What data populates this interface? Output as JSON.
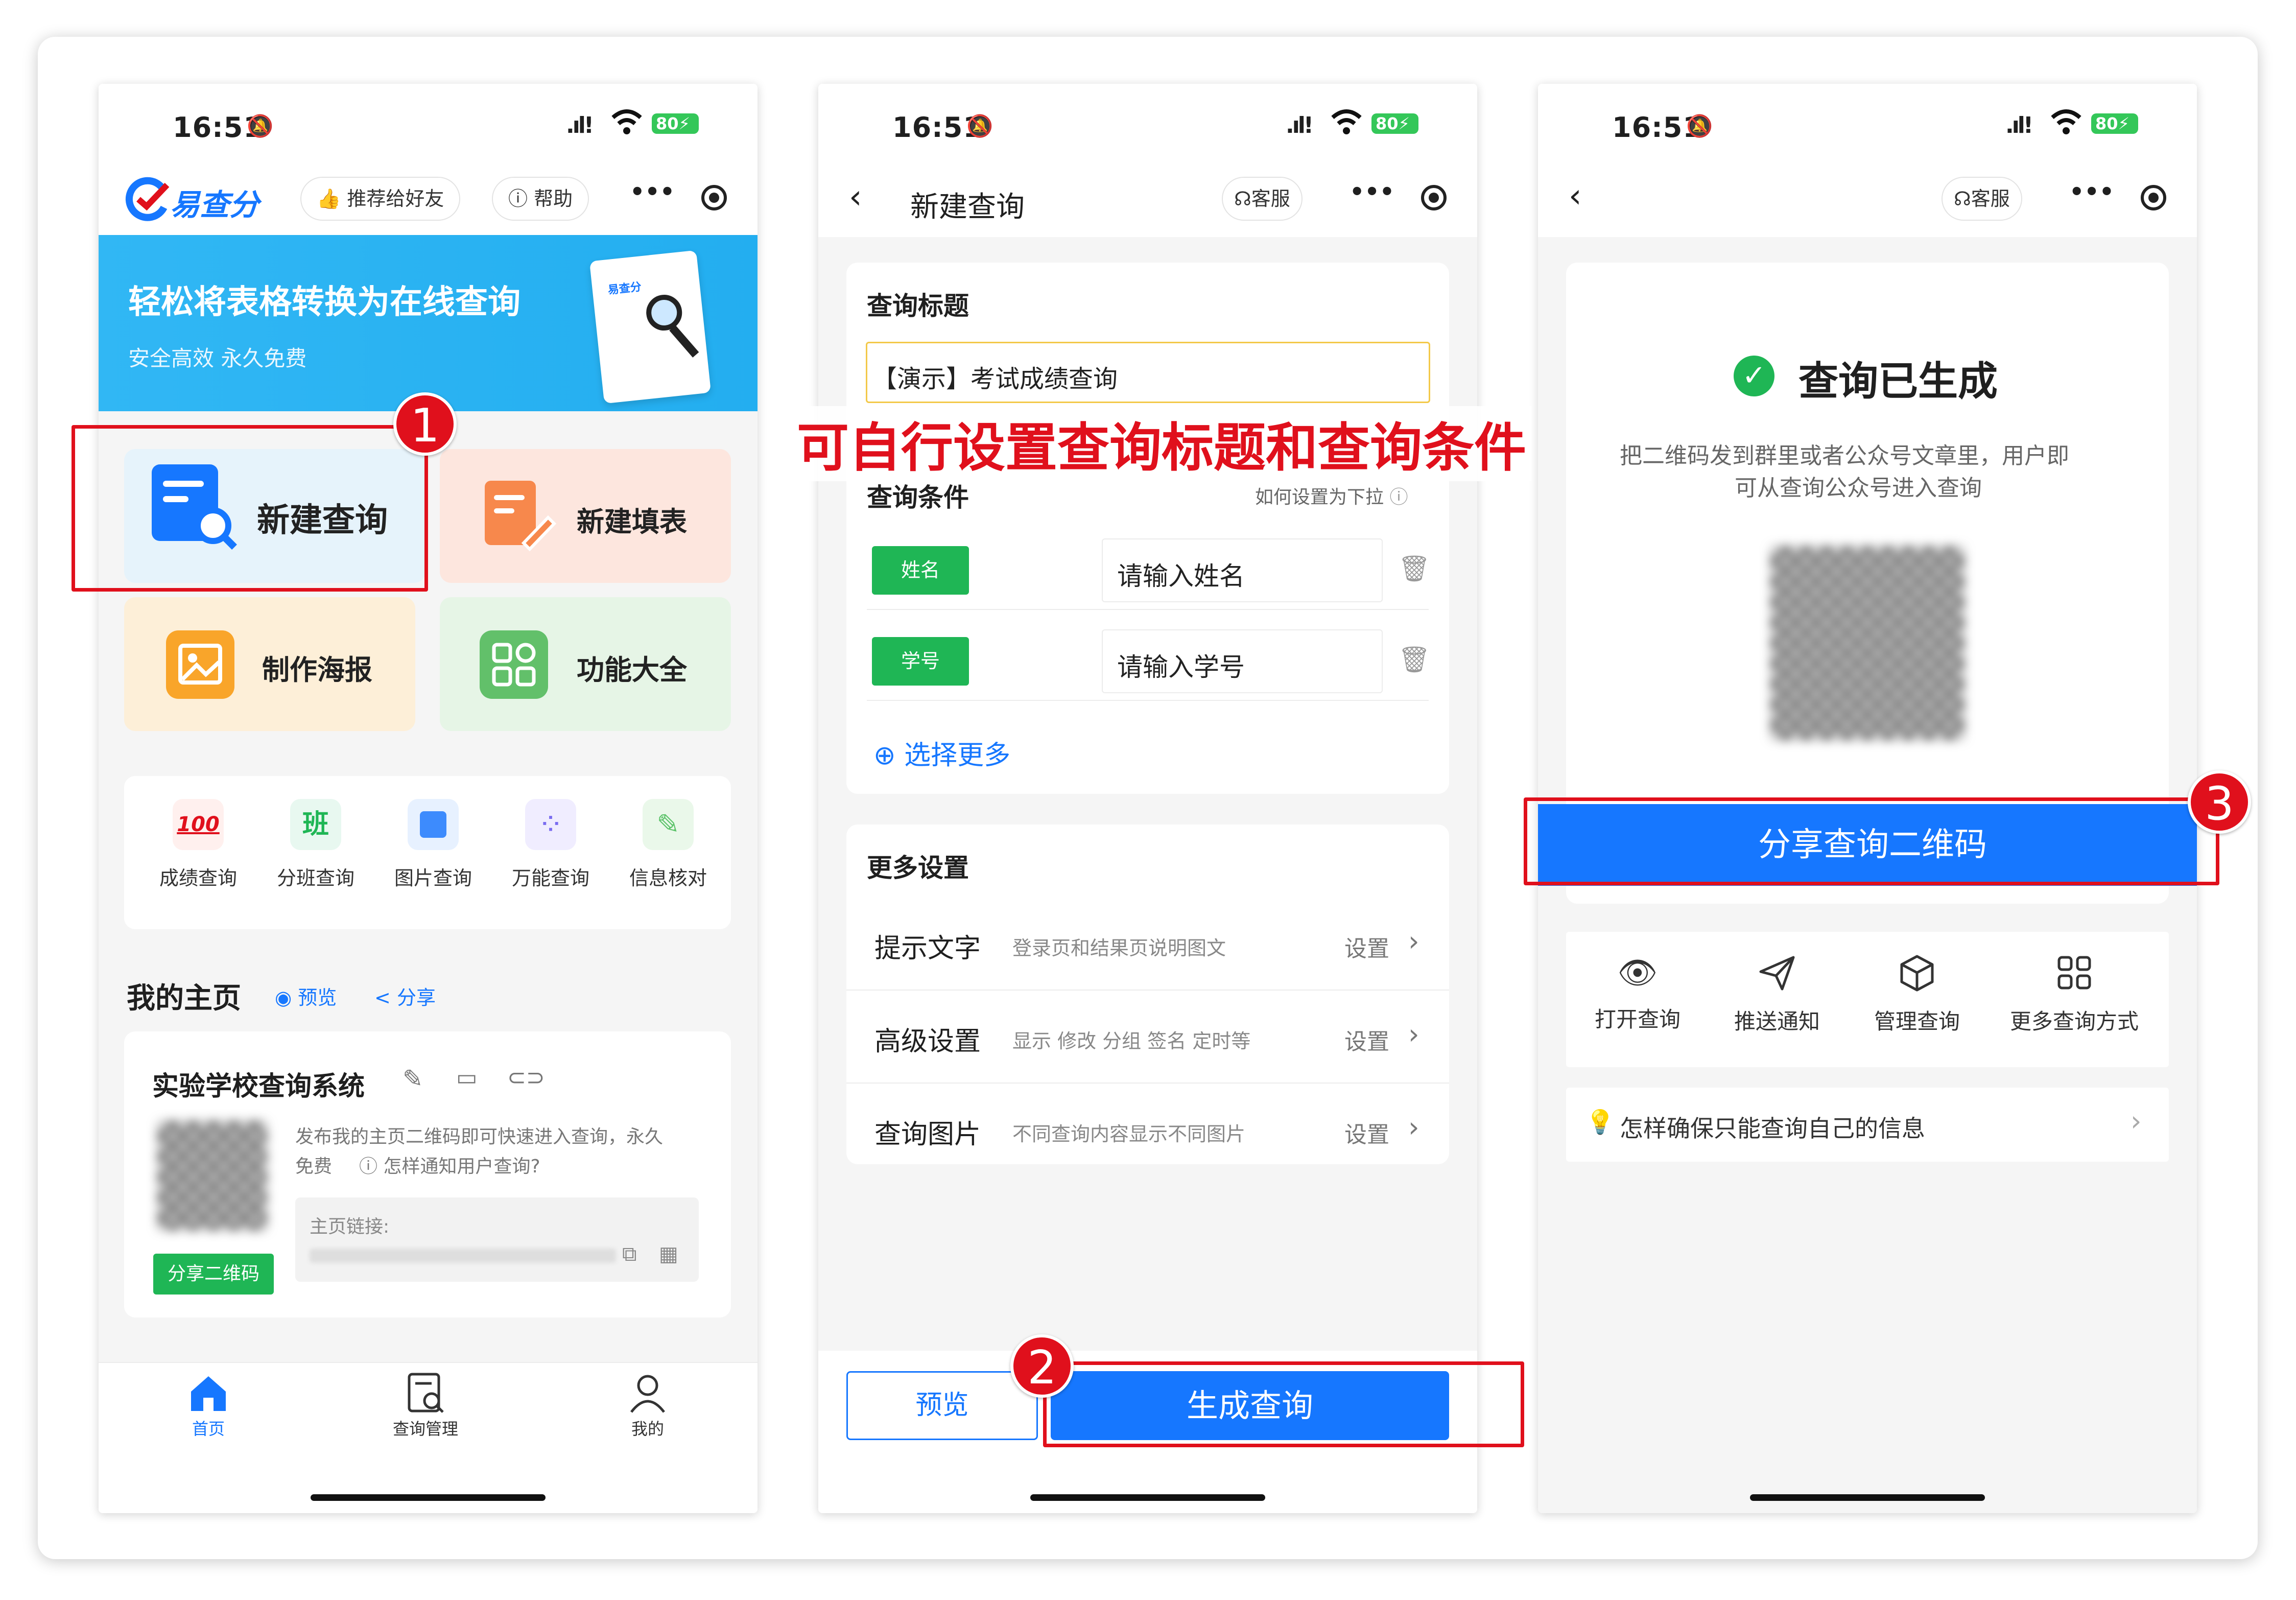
{
  "status": {
    "time": "16:51",
    "battery": "80"
  },
  "phone1": {
    "logo": "易查分",
    "recommend": "推荐给好友",
    "help": "帮助",
    "banner_title": "轻松将表格转换为在线查询",
    "banner_sub": "安全高效 永久免费",
    "banner_doc_logo": "易查分",
    "tiles": [
      "新建查询",
      "新建填表",
      "制作海报",
      "功能大全"
    ],
    "quick": [
      {
        "icon": "100-score-icon",
        "glyph": "100",
        "label": "成绩查询"
      },
      {
        "icon": "class-icon",
        "glyph": "班",
        "label": "分班查询"
      },
      {
        "icon": "picture-icon",
        "glyph": "",
        "label": "图片查询"
      },
      {
        "icon": "grid-icon",
        "glyph": "",
        "label": "万能查询"
      },
      {
        "icon": "check-doc-icon",
        "glyph": "",
        "label": "信息核对"
      }
    ],
    "my_home": "我的主页",
    "preview": "预览",
    "share": "分享",
    "school": "实验学校查询系统",
    "publish_text_1": "发布我的主页二维码即可快速进入查询，永久",
    "publish_text_2": "免费",
    "notify_link": "怎样通知用户查询?",
    "home_link_label": "主页链接:",
    "share_qr": "分享二维码",
    "tabs": [
      "首页",
      "查询管理",
      "我的"
    ]
  },
  "phone2": {
    "title": "新建查询",
    "service": "客服",
    "q_title_label": "查询标题",
    "q_title_value": "【演示】考试成绩查询",
    "annotation": "可自行设置查询标题和查询条件",
    "cond_label": "查询条件",
    "dropdown_help": "如何设置为下拉",
    "conditions": [
      {
        "tag": "姓名",
        "placeholder": "请输入姓名"
      },
      {
        "tag": "学号",
        "placeholder": "请输入学号"
      }
    ],
    "select_more": "选择更多",
    "more_settings": "更多设置",
    "settings": [
      {
        "name": "提示文字",
        "desc": "登录页和结果页说明图文",
        "action": "设置"
      },
      {
        "name": "高级设置",
        "desc": "显示 修改 分组 签名 定时等",
        "action": "设置"
      },
      {
        "name": "查询图片",
        "desc": "不同查询内容显示不同图片",
        "action": "设置"
      }
    ],
    "preview_btn": "预览",
    "generate_btn": "生成查询"
  },
  "phone3": {
    "service": "客服",
    "done_title": "查询已生成",
    "done_desc_1": "把二维码发到群里或者公众号文章里，用户即",
    "done_desc_2": "可从查询公众号进入查询",
    "share_btn": "分享查询二维码",
    "actions": [
      {
        "icon": "eye-icon",
        "label": "打开查询"
      },
      {
        "icon": "send-icon",
        "label": "推送通知"
      },
      {
        "icon": "box-icon",
        "label": "管理查询"
      },
      {
        "icon": "grid-icon",
        "label": "更多查询方式"
      }
    ],
    "tip": "怎样确保只能查询自己的信息"
  },
  "badges": [
    "1",
    "2",
    "3"
  ],
  "colors": {
    "primary": "#1677ff",
    "red": "#e0101c",
    "green": "#1fb655",
    "banner": "#2ab4f3"
  }
}
